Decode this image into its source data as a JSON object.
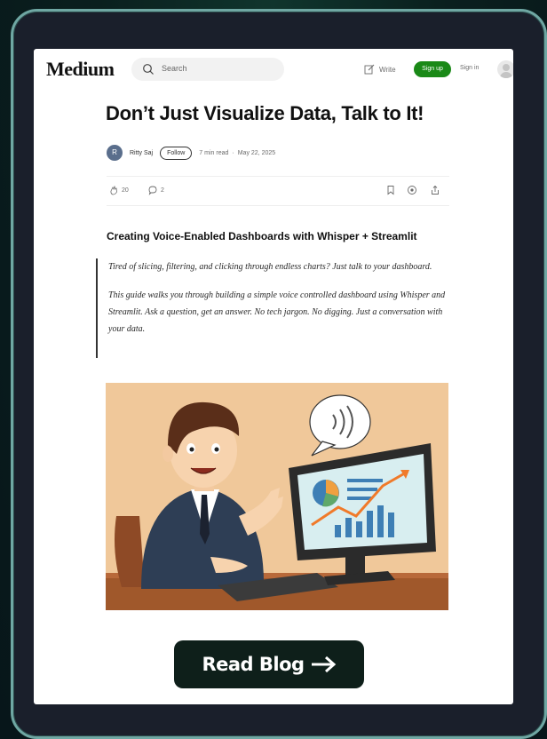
{
  "header": {
    "logo": "Medium",
    "search_placeholder": "Search",
    "write_label": "Write",
    "signup_label": "Sign up",
    "signin_label": "Sign in"
  },
  "article": {
    "title": "Don’t Just Visualize Data, Talk to It!",
    "author_initial": "R",
    "author": "Ritty Saj",
    "follow_label": "Follow",
    "read_time": "7 min read",
    "separator": "·",
    "date": "May 22, 2025",
    "claps": "20",
    "responses": "2",
    "subheading": "Creating Voice-Enabled Dashboards with Whisper + Streamlit",
    "quote_p1": "Tired of slicing, filtering, and clicking through endless charts? Just talk to your dashboard.",
    "quote_p2": "This guide walks you through building a simple voice controlled dashboard using Whisper and Streamlit. Ask a question, get an answer. No tech jargon. No digging. Just a conversation with your data."
  },
  "cta": {
    "label": "Read Blog"
  },
  "colors": {
    "accent_green": "#1a8917",
    "cta_bg": "#0e1f1a",
    "device_border": "#6fa7a3",
    "illustration_bg": "#f0c89a"
  },
  "icons": [
    "search-icon",
    "write-icon",
    "clap-icon",
    "comment-icon",
    "bookmark-icon",
    "listen-icon",
    "share-icon",
    "arrow-right-icon"
  ]
}
